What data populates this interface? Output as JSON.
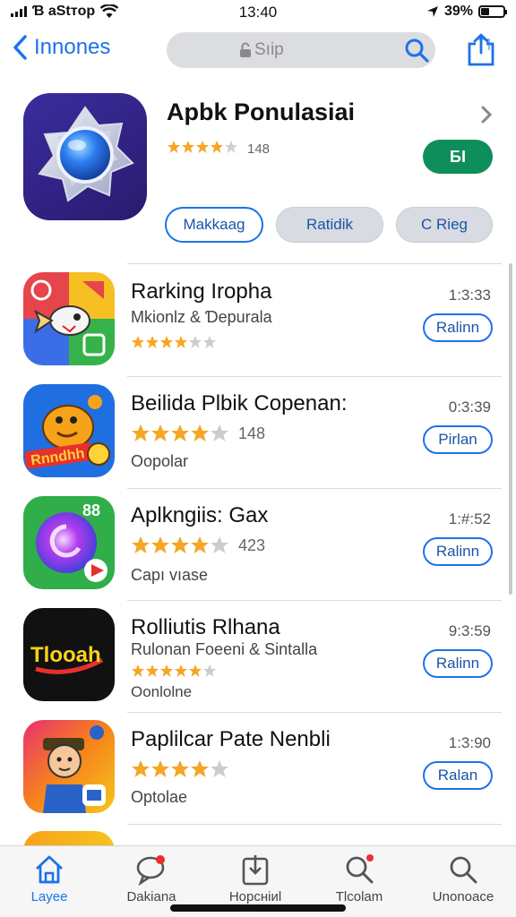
{
  "status_bar": {
    "carrier": "Ɓ aStтop",
    "time": "13:40",
    "battery": "39%",
    "battery_level": 0.39
  },
  "nav": {
    "back_label": "Innones",
    "search_placeholder": "Sıip"
  },
  "featured": {
    "title": "Apbk Ponulasiai",
    "rating_count": "148",
    "get_label": "БI",
    "buttons": [
      "Makkaag",
      "Ratidik",
      "C Rieg"
    ]
  },
  "apps": [
    {
      "title": "Rarking Iropha",
      "subtitle": "Mkionlz & Ɗepurala",
      "reviews": "",
      "category": "",
      "time": "1:3:33",
      "action": "Ralinn",
      "stars": 4
    },
    {
      "title": "Beilida Plbik Copenan:",
      "subtitle": "",
      "reviews": "148",
      "category": "Oopolar",
      "time": "0:3:39",
      "action": "Pirlan",
      "stars": 4
    },
    {
      "title": "Aplkngiis: Gax",
      "subtitle": "",
      "reviews": "423",
      "category": "Capı vıase",
      "time": "1:#:52",
      "action": "Ralinn",
      "stars": 4
    },
    {
      "title": "Rolliutis Rlhana",
      "subtitle": "Rulonan Foeeni & Sintalla",
      "reviews": "",
      "category": "Oonlolne",
      "time": "9:3:59",
      "action": "Ralinn",
      "stars": 4
    },
    {
      "title": "Paplilcar Pate Nenbli",
      "subtitle": "",
      "reviews": "",
      "category": "Optolae",
      "time": "1:3:90",
      "action": "Ralan",
      "stars": 4
    }
  ],
  "icon_labels": {
    "tiktok_like": "88",
    "tloooh": "Tlooah",
    "kids": "Rnndhh"
  },
  "tabs": [
    "Layee",
    "Dakiana",
    "Норсніиl",
    "Tlcolam",
    "Unonoace"
  ],
  "colors": {
    "accent": "#1a73e8",
    "get_button": "#0e8e5b",
    "star": "#f5a623"
  }
}
